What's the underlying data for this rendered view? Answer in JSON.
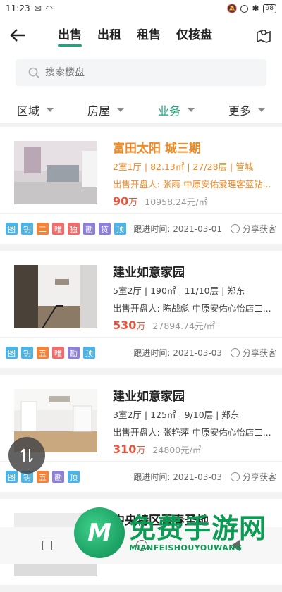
{
  "status_bar": {
    "time": "11:23",
    "battery": "98"
  },
  "header": {
    "tabs": [
      {
        "label": "出售",
        "active": true
      },
      {
        "label": "出租",
        "active": false
      },
      {
        "label": "租售",
        "active": false
      },
      {
        "label": "仅核盘",
        "active": false
      }
    ]
  },
  "search": {
    "placeholder": "搜索楼盘"
  },
  "filters": [
    {
      "label": "区域",
      "active": false
    },
    {
      "label": "房屋",
      "active": false
    },
    {
      "label": "业务",
      "active": true
    },
    {
      "label": "更多",
      "active": false
    }
  ],
  "listings": [
    {
      "title": "富田太阳 城三期",
      "spec": "2室1厅 | 82.13㎡ | 27/28层 | 管城",
      "agent": "出售开盘人: 张雨-中原安佑爱理客蓝钻...",
      "price": "90",
      "price_unit": "万",
      "unit_price": "10958.24元/㎡",
      "tags": [
        "图",
        "钥",
        "二",
        "唯",
        "独",
        "勘",
        "贷",
        "顶"
      ],
      "follow": "跟进时间: 2021-03-01",
      "share": "分享获客"
    },
    {
      "title": "建业如意家园",
      "spec": "5室2厅 | 190㎡ | 11/10层 | 郑东",
      "agent": "出售开盘人: 陈战彪-中原安佑心怡店二...",
      "price": "530",
      "price_unit": "万",
      "unit_price": "27894.74元/㎡",
      "tags": [
        "图",
        "钥",
        "五",
        "唯",
        "勘",
        "顶"
      ],
      "follow": "跟进时间: 2021-03-03",
      "share": "分享获客"
    },
    {
      "title": "建业如意家园",
      "spec": "3室2厅 | 125㎡ | 9/10层 | 郑东",
      "agent": "出售开盘人: 张艳萍-中原安佑心怡店二...",
      "price": "310",
      "price_unit": "万",
      "unit_price": "24800元/㎡",
      "tags": [
        "图",
        "钥",
        "五",
        "勘",
        "顶"
      ],
      "follow": "跟进时间: 2021-03-03",
      "share": "分享获客"
    },
    {
      "title": "中央特区青春圣地",
      "spec": "",
      "agent": "",
      "price": "",
      "price_unit": "",
      "unit_price": "",
      "tags": [],
      "follow": "",
      "share": ""
    }
  ],
  "watermark": {
    "cn": "免费手游网",
    "en": "MIANFEISHOUYOUWANG",
    "logo": "M"
  },
  "colors": {
    "accent": "#19a97b",
    "orange": "#f08a24",
    "price": "#e8553d"
  }
}
